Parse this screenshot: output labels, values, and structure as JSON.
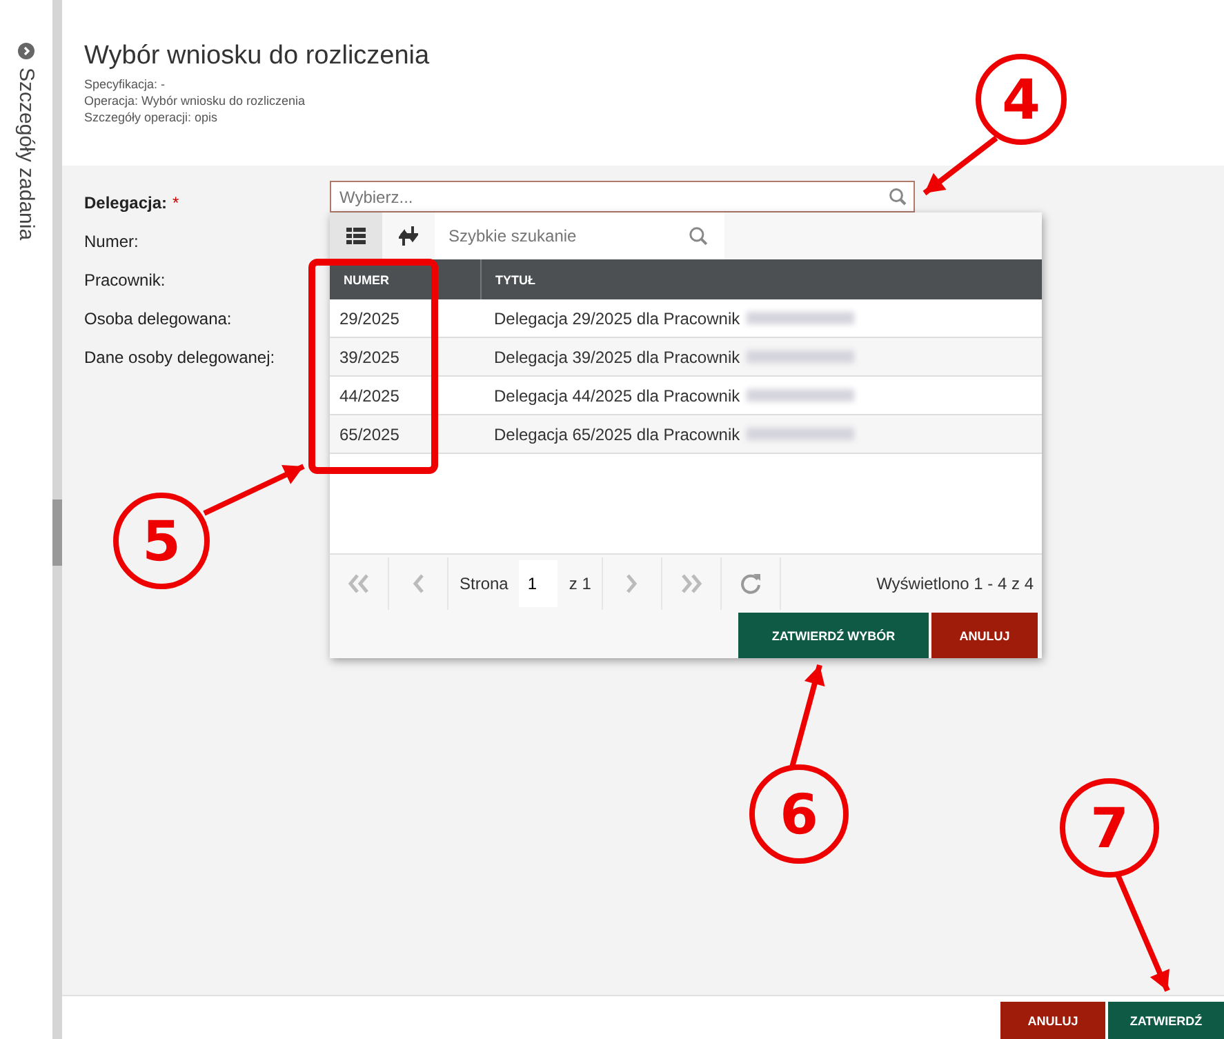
{
  "sidebar": {
    "label": "Szczegóły zadania"
  },
  "header": {
    "title": "Wybór wniosku do rozliczenia",
    "details": [
      "Specyfikacja: -",
      "Operacja: Wybór wniosku do rozliczenia",
      "Szczegóły operacji: opis"
    ]
  },
  "form": {
    "fields": [
      {
        "label": "Delegacja:",
        "required_mark": "*",
        "placeholder": "Wybierz..."
      },
      {
        "label": "Numer:"
      },
      {
        "label": "Pracownik:"
      },
      {
        "label": "Osoba delegowana:"
      },
      {
        "label": "Dane osoby delegowanej:"
      }
    ]
  },
  "picker": {
    "search_placeholder": "Szybkie szukanie",
    "columns": [
      "NUMER",
      "TYTUŁ"
    ],
    "rows": [
      {
        "numer": "29/2025",
        "tytul": "Delegacja 29/2025 dla Pracownik",
        "name_blurred": true
      },
      {
        "numer": "39/2025",
        "tytul": "Delegacja 39/2025 dla Pracownik",
        "name_blurred": true
      },
      {
        "numer": "44/2025",
        "tytul": "Delegacja 44/2025 dla Pracownik",
        "name_blurred": true
      },
      {
        "numer": "65/2025",
        "tytul": "Delegacja 65/2025 dla Pracownik",
        "name_blurred": true
      }
    ],
    "pager": {
      "page_label": "Strona",
      "page": "1",
      "of": "z 1",
      "summary": "Wyświetlono 1 - 4 z 4"
    },
    "buttons": [
      {
        "label": "ZATWIERDŹ WYBÓR",
        "kind": "confirm"
      },
      {
        "label": "ANULUJ",
        "kind": "cancel"
      }
    ]
  },
  "footer": {
    "buttons": [
      {
        "label": "ANULUJ",
        "kind": "cancel"
      },
      {
        "label": "ZATWIERDŹ",
        "kind": "confirm"
      }
    ]
  },
  "annotations": [
    {
      "number": "4"
    },
    {
      "number": "5"
    },
    {
      "number": "6"
    },
    {
      "number": "7"
    }
  ]
}
